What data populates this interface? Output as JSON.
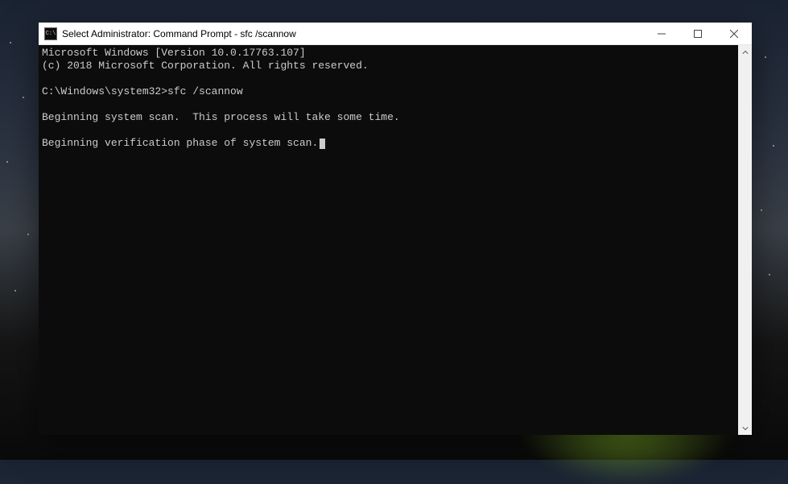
{
  "window": {
    "title": "Select Administrator: Command Prompt - sfc  /scannow",
    "icon_glyph": "C:\\"
  },
  "console": {
    "line1": "Microsoft Windows [Version 10.0.17763.107]",
    "line2": "(c) 2018 Microsoft Corporation. All rights reserved.",
    "blank1": "",
    "prompt": "C:\\Windows\\system32>",
    "command": "sfc /scannow",
    "blank2": "",
    "scan1": "Beginning system scan.  This process will take some time.",
    "blank3": "",
    "scan2": "Beginning verification phase of system scan."
  }
}
